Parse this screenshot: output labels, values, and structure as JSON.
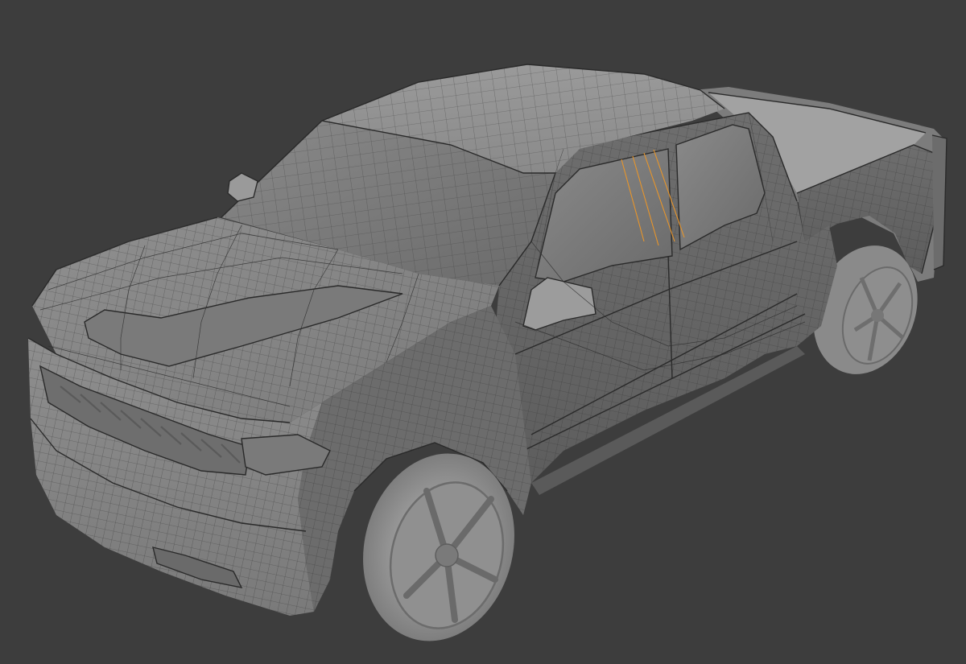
{
  "viewport": {
    "background_color": "#3d3d3d",
    "mesh_color": "#8c8c8c",
    "wire_color": "#303030",
    "selection_color": "#e8952a",
    "object": "pickup-truck-mesh"
  }
}
